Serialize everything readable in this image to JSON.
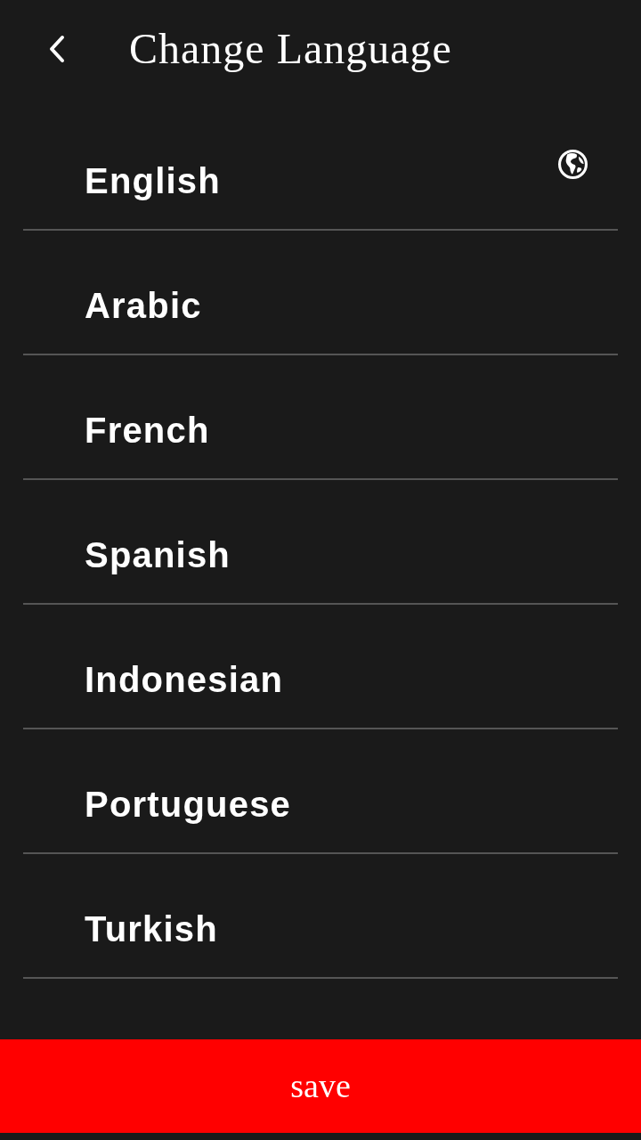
{
  "header": {
    "title": "Change Language"
  },
  "languages": [
    {
      "label": "English",
      "selected": true
    },
    {
      "label": "Arabic",
      "selected": false
    },
    {
      "label": "French",
      "selected": false
    },
    {
      "label": "Spanish",
      "selected": false
    },
    {
      "label": "Indonesian",
      "selected": false
    },
    {
      "label": "Portuguese",
      "selected": false
    },
    {
      "label": "Turkish",
      "selected": false
    }
  ],
  "save_button": {
    "label": "save"
  }
}
